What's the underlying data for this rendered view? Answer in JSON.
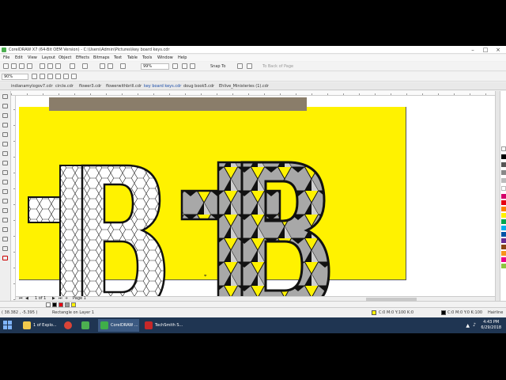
{
  "window": {
    "title": "CorelDRAW X7 (64-Bit OEM Version) - C:\\Users\\Admin\\Pictures\\key board keys.cdr"
  },
  "menu": [
    "File",
    "Edit",
    "View",
    "Layout",
    "Object",
    "Effects",
    "Bitmaps",
    "Text",
    "Table",
    "Tools",
    "Window",
    "Help"
  ],
  "toolbar": {
    "zoom_value": "99%",
    "snap_label": "Snap To",
    "to_back_label": "To Back of Page"
  },
  "propbar": {
    "zoom_select": "90%"
  },
  "doc_tabs": [
    {
      "label": "indianamylogov7.cdr",
      "active": false
    },
    {
      "label": "circle.cdr",
      "active": false
    },
    {
      "label": "flower3.cdr",
      "active": false
    },
    {
      "label": "flowerwithbrill.cdr",
      "active": false
    },
    {
      "label": "key board keys.cdr",
      "active": true
    },
    {
      "label": "doug book5.cdr",
      "active": false
    },
    {
      "label": "Ehlive_Ministeries (1).cdr",
      "active": false
    }
  ],
  "canvas": {
    "page_color": "#fff200",
    "letter_glyph": "B"
  },
  "page_nav": {
    "counter": "1 of 1",
    "page_label": "Page 1"
  },
  "status": {
    "coords": "( 38.382 , -5.395 )",
    "selection": "Rectangle on Layer 1",
    "fill_info": "C:0 M:0 Y:100 K:0",
    "outline_info": "C:0 M:0 Y:0 K:100",
    "outline_label": "Hairline"
  },
  "taskbar": {
    "items": [
      {
        "label": "1 of Explo...",
        "icon": "file-explorer-icon"
      },
      {
        "label": "",
        "icon": "chrome-icon"
      },
      {
        "label": "",
        "icon": "app-icon"
      },
      {
        "label": "CorelDRAW ...",
        "icon": "coreldraw-icon"
      },
      {
        "label": "TechSmith S...",
        "icon": "techsmith-icon"
      }
    ],
    "time": "4:43 PM",
    "date": "6/29/2018"
  },
  "colors": {
    "yellow": "#fff200",
    "gray": "#a0a0a0",
    "black": "#111111"
  }
}
